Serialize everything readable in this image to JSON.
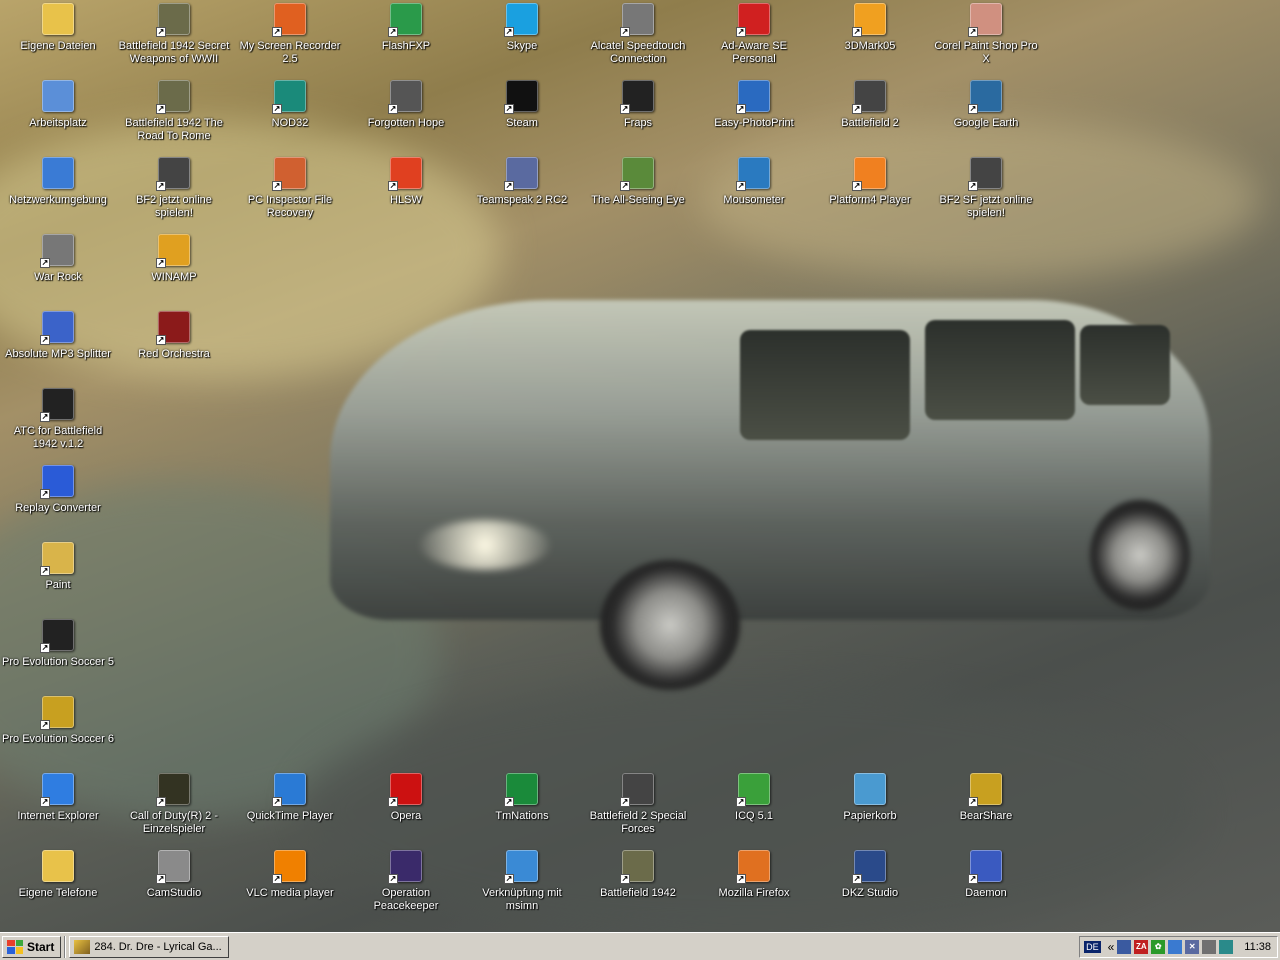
{
  "desktop": {
    "icons": [
      {
        "label": "Eigene Dateien",
        "icon": "folder-icon",
        "color": "#e8c24a"
      },
      {
        "label": "Arbeitsplatz",
        "icon": "computer-icon",
        "color": "#5b8fd8"
      },
      {
        "label": "Netzwerkumgebung",
        "icon": "network-icon",
        "color": "#3a7bd5"
      },
      {
        "label": "War Rock",
        "icon": "war-rock-icon",
        "color": "#777777"
      },
      {
        "label": "Absolute MP3 Splitter",
        "icon": "mp3-splitter-icon",
        "color": "#3b63c9"
      },
      {
        "label": "ATC for Battlefield 1942 v.1.2",
        "icon": "atc-icon",
        "color": "#222222"
      },
      {
        "label": "Replay Converter",
        "icon": "replay-converter-icon",
        "color": "#2a5bd7"
      },
      {
        "label": "Paint",
        "icon": "paint-icon",
        "color": "#d9b44a"
      },
      {
        "label": "Pro Evolution Soccer 5",
        "icon": "pes5-icon",
        "color": "#222222"
      },
      {
        "label": "Pro Evolution Soccer 6",
        "icon": "pes6-icon",
        "color": "#c8a020"
      },
      {
        "label": "Internet Explorer",
        "icon": "internet-explorer-icon",
        "color": "#2f7de1"
      },
      {
        "label": "Eigene Telefone",
        "icon": "phone-folder-icon",
        "color": "#e8c24a"
      },
      {
        "label": "Battlefield 1942 Secret Weapons of WWII",
        "icon": "battlefield-icon",
        "color": "#6b6b4a"
      },
      {
        "label": "Battlefield 1942 The Road To Rome",
        "icon": "battlefield-icon",
        "color": "#6b6b4a"
      },
      {
        "label": "BF2 jetzt online spielen!",
        "icon": "battlefield2-icon",
        "color": "#444444"
      },
      {
        "label": "WINAMP",
        "icon": "winamp-icon",
        "color": "#e0a020"
      },
      {
        "label": "Red Orchestra",
        "icon": "red-orchestra-icon",
        "color": "#8b1a1a"
      },
      {
        "label": "Call of Duty(R) 2 - Einzelspieler",
        "icon": "call-of-duty-icon",
        "color": "#333322"
      },
      {
        "label": "CamStudio",
        "icon": "camstudio-icon",
        "color": "#8a8a8a"
      },
      {
        "label": "My Screen Recorder 2.5",
        "icon": "screen-recorder-icon",
        "color": "#e06020"
      },
      {
        "label": "NOD32",
        "icon": "nod32-icon",
        "color": "#1a8a7a"
      },
      {
        "label": "PC Inspector File Recovery",
        "icon": "file-recovery-icon",
        "color": "#d06030"
      },
      {
        "label": "QuickTime Player",
        "icon": "quicktime-icon",
        "color": "#2a7ad5"
      },
      {
        "label": "VLC media player",
        "icon": "vlc-icon",
        "color": "#f08000"
      },
      {
        "label": "FlashFXP",
        "icon": "flashfxp-icon",
        "color": "#2a9a4a"
      },
      {
        "label": "Forgotten Hope",
        "icon": "forgotten-hope-icon",
        "color": "#555555"
      },
      {
        "label": "HLSW",
        "icon": "hlsw-icon",
        "color": "#e04020"
      },
      {
        "label": "Opera",
        "icon": "opera-icon",
        "color": "#cc1111"
      },
      {
        "label": "Operation Peacekeeper",
        "icon": "operation-peacekeeper-icon",
        "color": "#3a2a6a"
      },
      {
        "label": "Skype",
        "icon": "skype-icon",
        "color": "#1aa0e0"
      },
      {
        "label": "Steam",
        "icon": "steam-icon",
        "color": "#111111"
      },
      {
        "label": "Teamspeak 2 RC2",
        "icon": "teamspeak-icon",
        "color": "#5a6aa0"
      },
      {
        "label": "TmNations",
        "icon": "tmnations-icon",
        "color": "#1a8a3a"
      },
      {
        "label": "Verknüpfung mit msimn",
        "icon": "outlook-express-icon",
        "color": "#3a8ad5"
      },
      {
        "label": "Alcatel Speedtouch Connection",
        "icon": "alcatel-icon",
        "color": "#777777"
      },
      {
        "label": "Fraps",
        "icon": "fraps-icon",
        "color": "#222222"
      },
      {
        "label": "The All-Seeing Eye",
        "icon": "all-seeing-eye-icon",
        "color": "#5a8a3a"
      },
      {
        "label": "Battlefield 2 Special Forces",
        "icon": "battlefield2-icon",
        "color": "#444444"
      },
      {
        "label": "Battlefield 1942",
        "icon": "battlefield-icon",
        "color": "#6b6b4a"
      },
      {
        "label": "Ad-Aware SE Personal",
        "icon": "ad-aware-icon",
        "color": "#d02020"
      },
      {
        "label": "Easy-PhotoPrint",
        "icon": "photoprint-icon",
        "color": "#2a6ac0"
      },
      {
        "label": "Mousometer",
        "icon": "mousometer-icon",
        "color": "#2a7ac0"
      },
      {
        "label": "ICQ 5.1",
        "icon": "icq-icon",
        "color": "#3aa03a"
      },
      {
        "label": "Mozilla Firefox",
        "icon": "firefox-icon",
        "color": "#e07020"
      },
      {
        "label": "3DMark05",
        "icon": "3dmark-icon",
        "color": "#f0a020"
      },
      {
        "label": "Battlefield 2",
        "icon": "battlefield2-icon",
        "color": "#444444"
      },
      {
        "label": "Platform4 Player",
        "icon": "platform4-icon",
        "color": "#f08020"
      },
      {
        "label": "Papierkorb",
        "icon": "recycle-bin-icon",
        "color": "#4a9ad0"
      },
      {
        "label": "DKZ Studio",
        "icon": "dkz-studio-icon",
        "color": "#2a4a8a"
      },
      {
        "label": "Corel Paint Shop Pro X",
        "icon": "paint-shop-pro-icon",
        "color": "#d09080"
      },
      {
        "label": "Google Earth",
        "icon": "google-earth-icon",
        "color": "#2a6aa0"
      },
      {
        "label": "BF2 SF jetzt online spielen!",
        "icon": "battlefield2-icon",
        "color": "#444444"
      },
      {
        "label": "BearShare",
        "icon": "bearshare-icon",
        "color": "#c8a020"
      },
      {
        "label": "Daemon",
        "icon": "daemon-tools-icon",
        "color": "#3a5ac0"
      }
    ]
  },
  "taskbar": {
    "start_label": "Start",
    "task_label": "284. Dr. Dre - Lyrical Ga...",
    "lang": "DE",
    "chevron": "«",
    "clock": "11:38",
    "tray_icons": [
      {
        "icon": "network-tray-icon",
        "color": "#3a5aa0",
        "glyph": ""
      },
      {
        "icon": "zonealarm-icon",
        "color": "#c02020",
        "glyph": "ZA"
      },
      {
        "icon": "icq-tray-icon",
        "color": "#2a9a2a",
        "glyph": "✿"
      },
      {
        "icon": "cursor-tray-icon",
        "color": "#3a7ad0",
        "glyph": ""
      },
      {
        "icon": "network-disconnected-icon",
        "color": "#5a6aa0",
        "glyph": "✕"
      },
      {
        "icon": "volume-icon",
        "color": "#707070",
        "glyph": ""
      },
      {
        "icon": "antivirus-tray-icon",
        "color": "#2a8a8a",
        "glyph": ""
      }
    ]
  }
}
